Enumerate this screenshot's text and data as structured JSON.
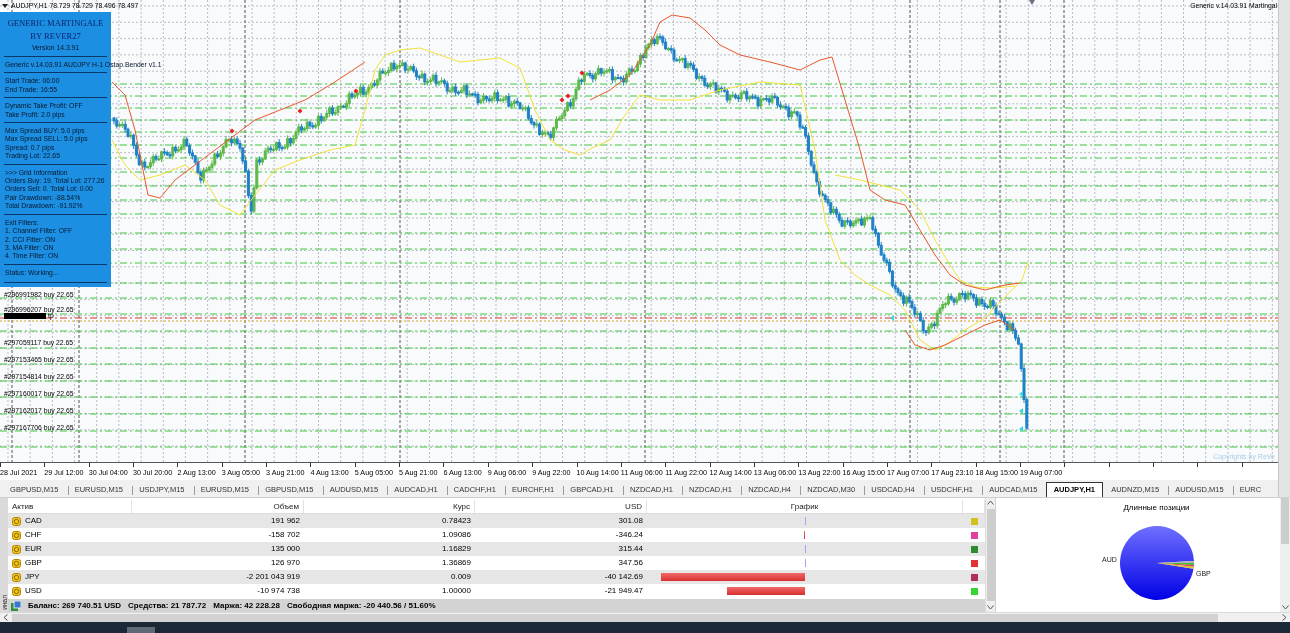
{
  "chart": {
    "header": "AUDJPY,H1 78.729 78.729 78.496 78.497",
    "expert_label": "Generic v.14.03.91 Martingal",
    "copyright": "Copyrights by ReVe",
    "info_panel": {
      "title_lines": [
        "GENERIC MARTINGALE",
        "BY REVER27"
      ],
      "version": "Version 14.3.91",
      "sections": [
        [
          "Generic v.14.03.91 AUDJPY H-1 Ostap.Bender v1.1"
        ],
        [
          "Start Trade: 06:00",
          "End Trade: 16:55"
        ],
        [
          "Dynamic Take Profit: OFF",
          "Take Profit: 2.0 pips"
        ],
        [
          "Max Spread BUY: 5.0 pips",
          "Max Spread SELL: 5.0 pips",
          "Spread: 0.7 pips",
          "Trading Lot: 22.65"
        ],
        [
          ">>> Grid Information",
          "Orders Buy: 19. Total Lot: 277.26",
          "Orders Sell: 0. Total Lot: 0.00",
          "Pair Drawdown: -88.54%",
          "Total Drawdown: -91.92%"
        ],
        [
          "Exit Filters:",
          "1. Channel Filter: OFF",
          "2. CCI Filter: ON",
          "3. MA Filter: ON",
          "4. Time Filter: ON"
        ],
        [
          "Status: Working..."
        ]
      ]
    },
    "order_labels": [
      {
        "kind": "order",
        "text": "#296991982 buy 22.65"
      },
      {
        "kind": "order",
        "text": "#296996207 buy 22.65"
      },
      {
        "kind": "masked",
        "text": "tp"
      },
      {
        "kind": "order",
        "text": "#297059117 buy 22.65"
      },
      {
        "kind": "order",
        "text": "#297153465 buy 22.65"
      },
      {
        "kind": "order",
        "text": "#297154814 buy 22.65"
      },
      {
        "kind": "order",
        "text": "#297160017 buy 22.65"
      },
      {
        "kind": "order",
        "text": "#297162017 buy 22.65"
      },
      {
        "kind": "order",
        "text": "#297167706 buy 22.65"
      }
    ],
    "time_axis": [
      "28 Jul 2021",
      "29 Jul 12:00",
      "30 Jul 04:00",
      "30 Jul 20:00",
      "2 Aug 13:00",
      "3 Aug 05:00",
      "3 Aug 21:00",
      "4 Aug 13:00",
      "5 Aug 05:00",
      "5 Aug 21:00",
      "6 Aug 13:00",
      "9 Aug 06:00",
      "9 Aug 22:00",
      "10 Aug 14:00",
      "11 Aug 06:00",
      "11 Aug 22:00",
      "12 Aug 14:00",
      "13 Aug 06:00",
      "13 Aug 22:00",
      "16 Aug 15:00",
      "17 Aug 07:00",
      "17 Aug 23:10",
      "18 Aug 15:00",
      "19 Aug 07:00"
    ]
  },
  "symbol_tabs": [
    {
      "label": "GBPUSD,M15",
      "selected": false
    },
    {
      "label": "EURUSD,M15",
      "selected": false
    },
    {
      "label": "USDJPY,M15",
      "selected": false
    },
    {
      "label": "EURUSD,M15",
      "selected": false
    },
    {
      "label": "GBPUSD,M15",
      "selected": false
    },
    {
      "label": "AUDUSD,M15",
      "selected": false
    },
    {
      "label": "AUDCAD,H1",
      "selected": false
    },
    {
      "label": "CADCHF,H1",
      "selected": false
    },
    {
      "label": "EURCHF,H1",
      "selected": false
    },
    {
      "label": "GBPCAD,H1",
      "selected": false
    },
    {
      "label": "NZDCAD,H1",
      "selected": false
    },
    {
      "label": "NZDCAD,H1",
      "selected": false
    },
    {
      "label": "NZDCAD,H4",
      "selected": false
    },
    {
      "label": "NZDCAD,M30",
      "selected": false
    },
    {
      "label": "USDCAD,H4",
      "selected": false
    },
    {
      "label": "USDCHF,H1",
      "selected": false
    },
    {
      "label": "AUDCAD,M15",
      "selected": false
    },
    {
      "label": "AUDJPY,H1",
      "selected": true
    },
    {
      "label": "AUDNZD,M15",
      "selected": false
    },
    {
      "label": "AUDUSD,M15",
      "selected": false
    },
    {
      "label": "EURC",
      "selected": false
    }
  ],
  "terminal": {
    "side_tab": "инал",
    "columns": [
      "Актив",
      "Объем",
      "Курс",
      "USD",
      "График"
    ],
    "rows": [
      {
        "asset": "CAD",
        "volume": "191 962",
        "rate": "0.78423",
        "usd": "301.08",
        "color": "#d4c21c"
      },
      {
        "asset": "CHF",
        "volume": "-158 702",
        "rate": "1.09086",
        "usd": "-346.24",
        "color": "#e0409a"
      },
      {
        "asset": "EUR",
        "volume": "135 000",
        "rate": "1.16829",
        "usd": "315.44",
        "color": "#2e8b2e"
      },
      {
        "asset": "GBP",
        "volume": "126 970",
        "rate": "1.36869",
        "usd": "347.56",
        "color": "#e03434"
      },
      {
        "asset": "JPY",
        "volume": "-2 201 043 919",
        "rate": "0.009",
        "usd": "-40 142.69",
        "color": "#b0305a"
      },
      {
        "asset": "USD",
        "volume": "-10 974 738",
        "rate": "1.00000",
        "usd": "-21 949.47",
        "color": "#33d633"
      }
    ],
    "summary": [
      "Баланс: 269 740.51 USD",
      "Средства: 21 787.72",
      "Маржа: 42 228.28",
      "Свободная маржа: -20 440.56 / 51.60%"
    ]
  },
  "pie": {
    "title": "Длинные позиции",
    "labels": [
      "AUD",
      "GBP"
    ]
  }
}
